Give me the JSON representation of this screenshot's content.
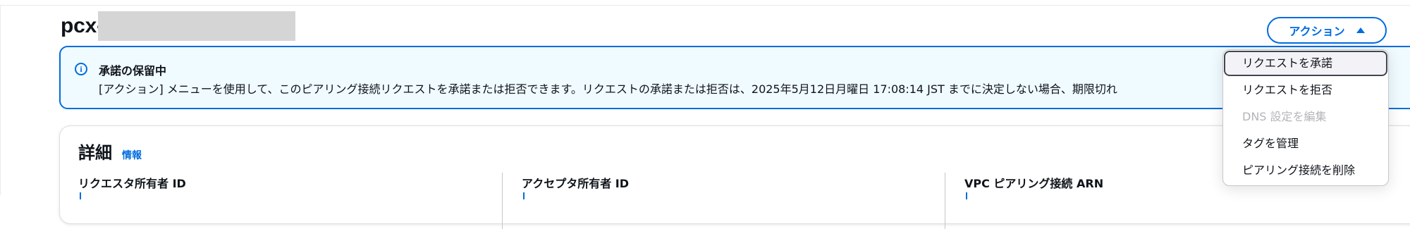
{
  "page": {
    "title": "pcx-"
  },
  "header": {
    "actions_label": "アクション"
  },
  "alert": {
    "title": "承諾の保留中",
    "body": "[アクション] メニューを使用して、このピアリング接続リクエストを承諾または拒否できます。リクエストの承諾または拒否は、2025年5月12日月曜日 17:08:14 JST までに決定しない場合、期限切れ"
  },
  "details": {
    "title": "詳細",
    "info_link": "情報",
    "columns": [
      {
        "label": "リクエスタ所有者 ID"
      },
      {
        "label": "アクセプタ所有者 ID"
      },
      {
        "label": "VPC ピアリング接続 ARN"
      }
    ]
  },
  "actions_menu": {
    "items": [
      {
        "label": "リクエストを承諾",
        "state": "highlighted"
      },
      {
        "label": "リクエストを拒否",
        "state": "enabled"
      },
      {
        "label": "DNS 設定を編集",
        "state": "disabled"
      },
      {
        "label": "タグを管理",
        "state": "enabled"
      },
      {
        "label": "ピアリング接続を削除",
        "state": "enabled"
      }
    ]
  },
  "colors": {
    "accent": "#006ce0",
    "alert_background": "#f0fbff",
    "disabled_text": "#b4b4bb"
  },
  "icons": {
    "alert": "info-icon",
    "actions_button": "caret-up-icon"
  }
}
